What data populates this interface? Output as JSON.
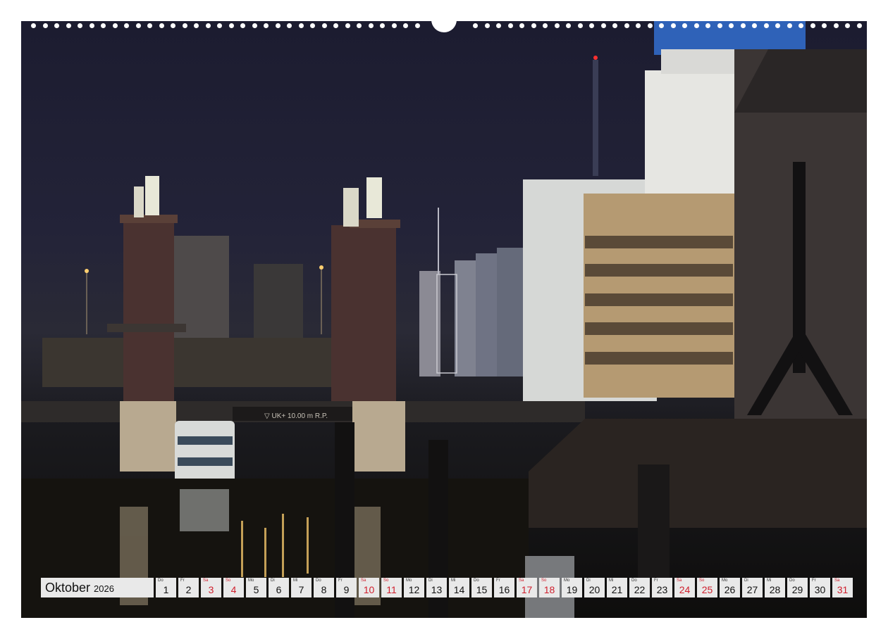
{
  "calendar": {
    "month": "Oktober",
    "year": "2026",
    "days": [
      {
        "wd": "Do",
        "num": "1",
        "weekend": false
      },
      {
        "wd": "Fr",
        "num": "2",
        "weekend": false
      },
      {
        "wd": "Sa",
        "num": "3",
        "weekend": true
      },
      {
        "wd": "So",
        "num": "4",
        "weekend": true
      },
      {
        "wd": "Mo",
        "num": "5",
        "weekend": false
      },
      {
        "wd": "Di",
        "num": "6",
        "weekend": false
      },
      {
        "wd": "Mi",
        "num": "7",
        "weekend": false
      },
      {
        "wd": "Do",
        "num": "8",
        "weekend": false
      },
      {
        "wd": "Fr",
        "num": "9",
        "weekend": false
      },
      {
        "wd": "Sa",
        "num": "10",
        "weekend": true
      },
      {
        "wd": "So",
        "num": "11",
        "weekend": true
      },
      {
        "wd": "Mo",
        "num": "12",
        "weekend": false
      },
      {
        "wd": "Di",
        "num": "13",
        "weekend": false
      },
      {
        "wd": "Mi",
        "num": "14",
        "weekend": false
      },
      {
        "wd": "Do",
        "num": "15",
        "weekend": false
      },
      {
        "wd": "Fr",
        "num": "16",
        "weekend": false
      },
      {
        "wd": "Sa",
        "num": "17",
        "weekend": true
      },
      {
        "wd": "So",
        "num": "18",
        "weekend": true
      },
      {
        "wd": "Mo",
        "num": "19",
        "weekend": false
      },
      {
        "wd": "Di",
        "num": "20",
        "weekend": false
      },
      {
        "wd": "Mi",
        "num": "21",
        "weekend": false
      },
      {
        "wd": "Do",
        "num": "22",
        "weekend": false
      },
      {
        "wd": "Fr",
        "num": "23",
        "weekend": false
      },
      {
        "wd": "Sa",
        "num": "24",
        "weekend": true
      },
      {
        "wd": "So",
        "num": "25",
        "weekend": true
      },
      {
        "wd": "Mo",
        "num": "26",
        "weekend": false
      },
      {
        "wd": "Di",
        "num": "27",
        "weekend": false
      },
      {
        "wd": "Mi",
        "num": "28",
        "weekend": false
      },
      {
        "wd": "Do",
        "num": "29",
        "weekend": false
      },
      {
        "wd": "Fr",
        "num": "30",
        "weekend": false
      },
      {
        "wd": "Sa",
        "num": "31",
        "weekend": true
      }
    ]
  },
  "photo": {
    "bridge_sign": "▽ UK+ 10.00 m R.P."
  },
  "colors": {
    "weekend": "#d0202e",
    "cell_bg": "#e9e9e9",
    "sky": "#232338",
    "water": "#0e0d0c"
  }
}
